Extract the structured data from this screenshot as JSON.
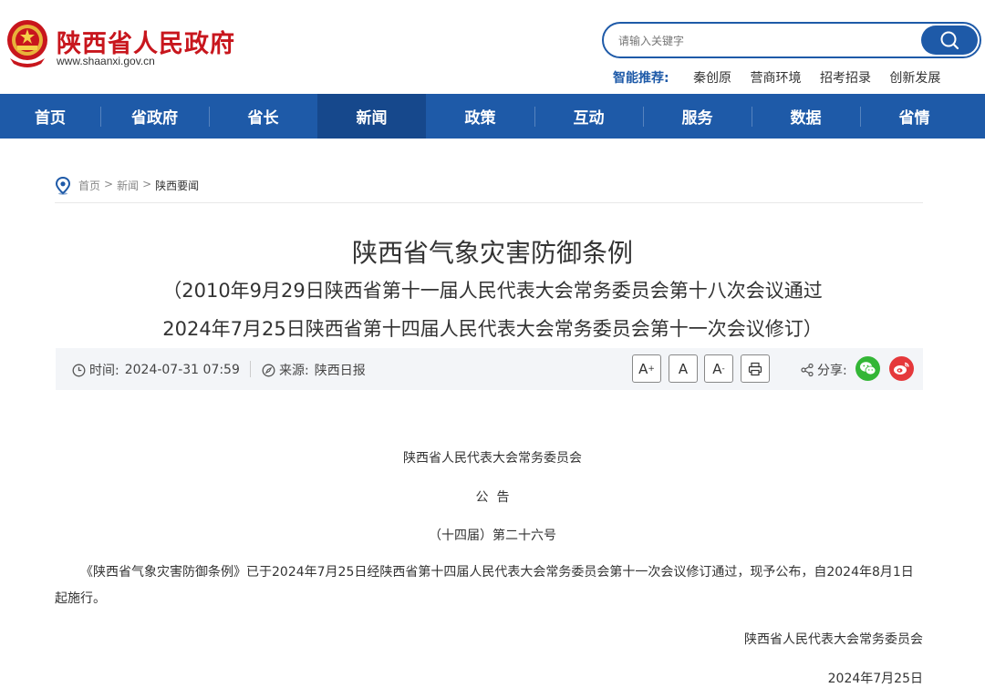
{
  "header": {
    "site_name": "陕西省人民政府",
    "site_url": "www.shaanxi.gov.cn",
    "search_placeholder": "请输入关键字",
    "recommend_label": "智能推荐:",
    "recommend_links": [
      "秦创原",
      "营商环境",
      "招考招录",
      "创新发展"
    ]
  },
  "nav": {
    "items": [
      "首页",
      "省政府",
      "省长",
      "新闻",
      "政策",
      "互动",
      "服务",
      "数据",
      "省情"
    ],
    "active_index": 3
  },
  "breadcrumb": {
    "items": [
      "首页",
      "新闻",
      "陕西要闻"
    ],
    "separator": ">"
  },
  "article": {
    "title": "陕西省气象灾害防御条例",
    "subtitle_line1": "（2010年9月29日陕西省第十一届人民代表大会常务委员会第十八次会议通过",
    "subtitle_line2": "2024年7月25日陕西省第十四届人民代表大会常务委员会第十一次会议修订）",
    "time_label": "时间:",
    "time_value": "2024-07-31 07:59",
    "source_label": "来源:",
    "source_value": "陕西日报",
    "font_buttons": [
      "A",
      "A",
      "A"
    ],
    "share_label": "分享:",
    "body": {
      "issuer": "陕西省人民代表大会常务委员会",
      "notice": "公  告",
      "number": "（十四届）第二十六号",
      "paragraph": "《陕西省气象灾害防御条例》已于2024年7月25日经陕西省第十四届人民代表大会常务委员会第十一次会议修订通过，现予公布，自2024年8月1日起施行。",
      "signature": "陕西省人民代表大会常务委员会",
      "date": "2024年7月25日"
    }
  },
  "colors": {
    "brand_red": "#c8161d",
    "nav_blue": "#1e5aa8",
    "nav_active": "#16488c",
    "wechat_green": "#33b636",
    "weibo_red": "#e5383b"
  }
}
